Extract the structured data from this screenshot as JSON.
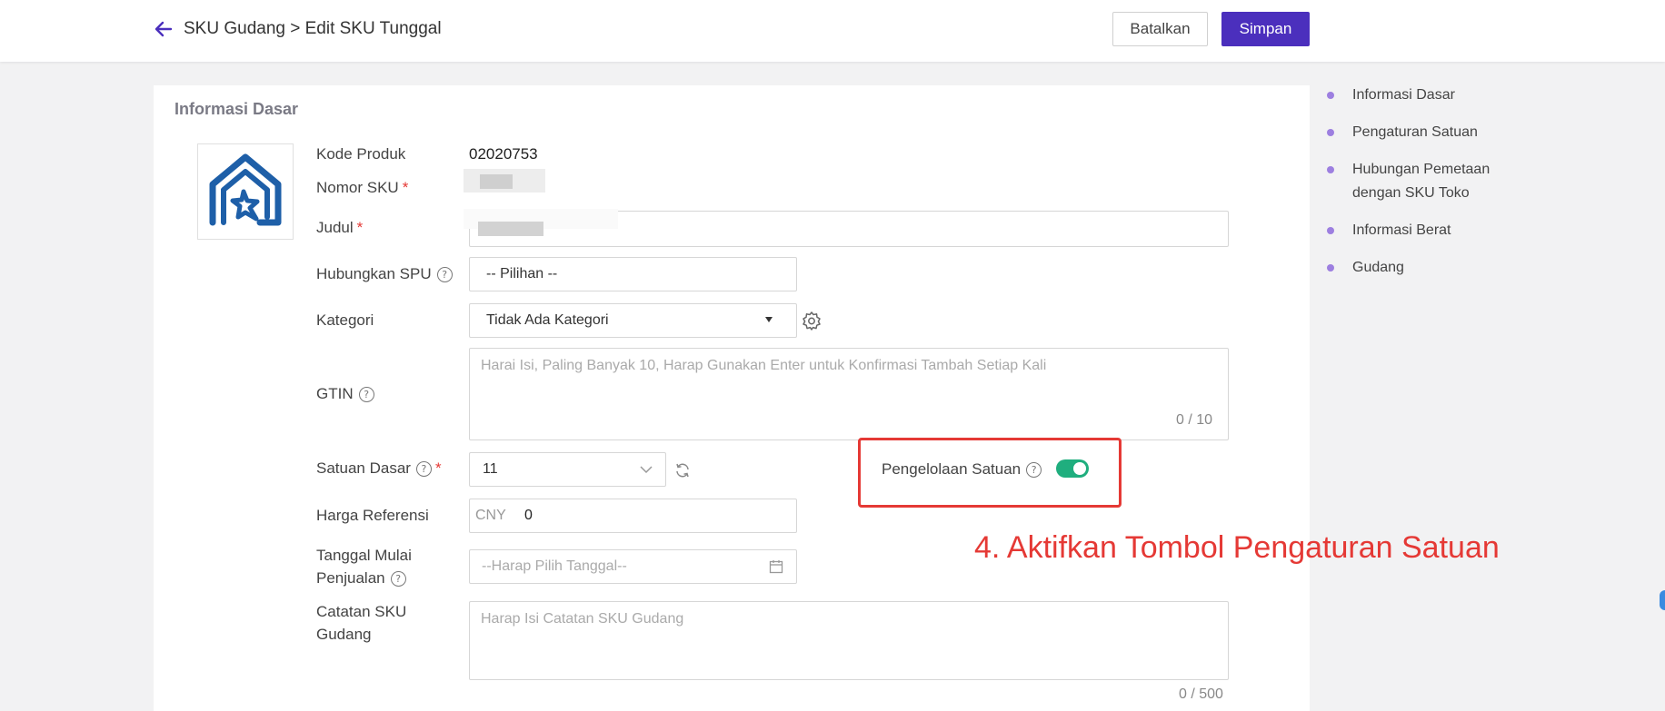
{
  "header": {
    "title": "SKU Gudang > Edit SKU Tunggal",
    "cancel_label": "Batalkan",
    "save_label": "Simpan"
  },
  "form": {
    "section_title": "Informasi Dasar",
    "product_code_label": "Kode Produk",
    "product_code_value": "02020753",
    "sku_number_label": "Nomor SKU",
    "title_label": "Judul",
    "link_spu_label": "Hubungkan SPU",
    "link_spu_value": "-- Pilihan --",
    "category_label": "Kategori",
    "category_value": "Tidak Ada Kategori",
    "gtin_label": "GTIN",
    "gtin_placeholder": "Harai Isi, Paling Banyak 10, Harap Gunakan Enter untuk Konfirmasi Tambah Setiap Kali",
    "gtin_counter": "0 / 10",
    "base_unit_label": "Satuan Dasar",
    "base_unit_value": "11",
    "unit_management_label": "Pengelolaan Satuan",
    "unit_management_enabled": true,
    "ref_price_label": "Harga Referensi",
    "ref_price_currency": "CNY",
    "ref_price_value": "0",
    "sale_start_label_line1": "Tanggal Mulai",
    "sale_start_label_line2": "Penjualan",
    "sale_start_placeholder": "--Harap Pilih Tanggal--",
    "notes_label_line1": "Catatan SKU",
    "notes_label_line2": "Gudang",
    "notes_placeholder": "Harap Isi Catatan SKU Gudang",
    "notes_counter": "0 / 500"
  },
  "anchor_nav": {
    "items": [
      "Informasi Dasar",
      "Pengaturan Satuan",
      "Hubungan Pemetaan dengan SKU Toko",
      "Informasi Berat",
      "Gudang"
    ]
  },
  "annotation": {
    "instruction": "4. Aktifkan Tombol Pengaturan Satuan"
  },
  "colors": {
    "primary": "#4b2fbd",
    "toggle_on": "#1fae7e",
    "highlight": "#e53935",
    "logo": "#1e5fa8"
  }
}
